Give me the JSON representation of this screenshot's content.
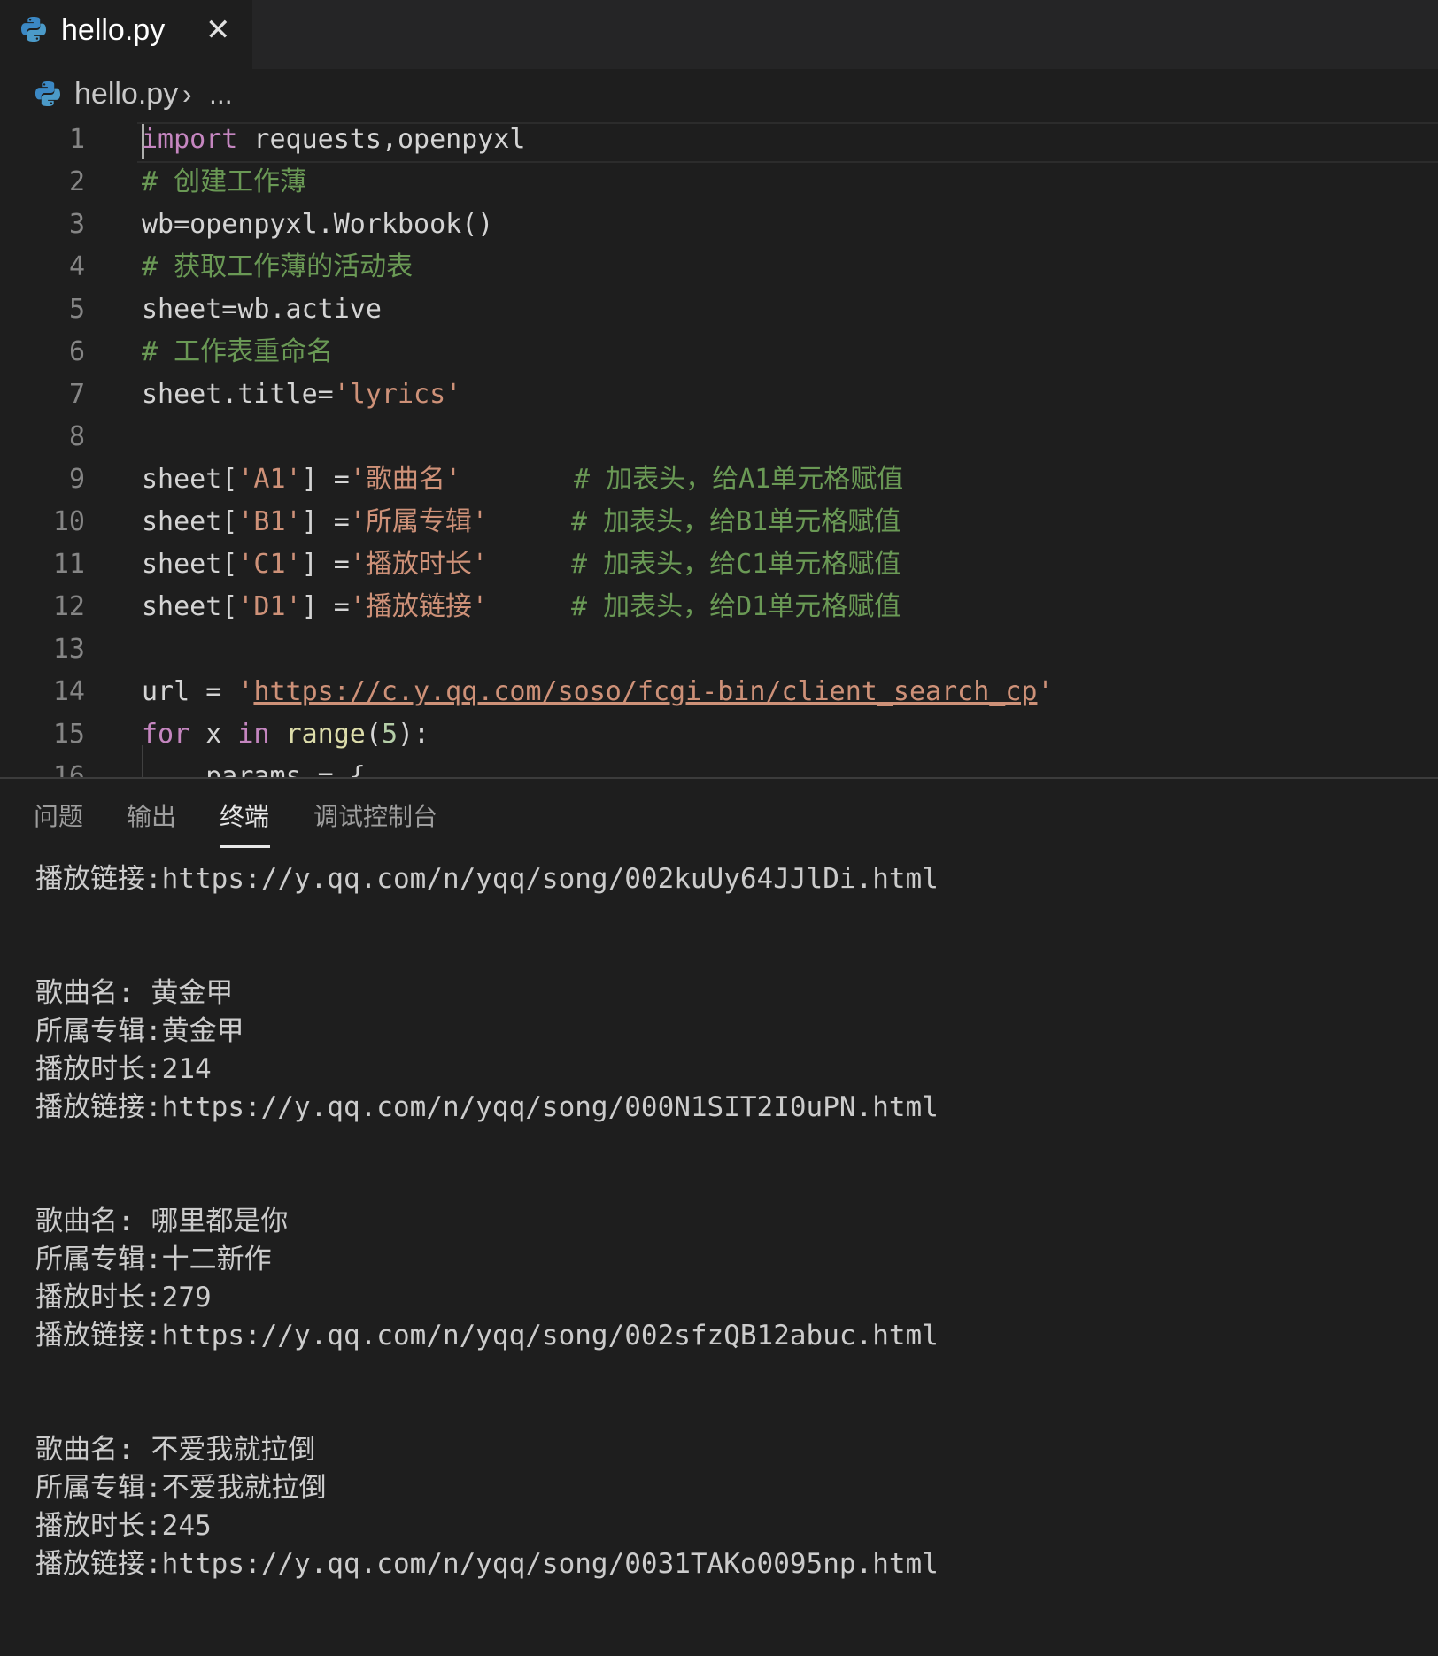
{
  "tab": {
    "filename": "hello.py",
    "close_glyph": "✕"
  },
  "breadcrumb": {
    "file": "hello.py",
    "separator": "›",
    "more": "..."
  },
  "editor": {
    "line_numbers": [
      "1",
      "2",
      "3",
      "4",
      "5",
      "6",
      "7",
      "8",
      "9",
      "10",
      "11",
      "12",
      "13",
      "14",
      "15",
      "16"
    ],
    "l1": {
      "kw": "import",
      "rest": " requests,openpyxl"
    },
    "l2": {
      "comment": "# 创建工作薄"
    },
    "l3": {
      "code": "wb=openpyxl.Workbook()"
    },
    "l4": {
      "comment": "# 获取工作薄的活动表"
    },
    "l5": {
      "code": "sheet=wb.active"
    },
    "l6": {
      "comment": "# 工作表重命名"
    },
    "l7": {
      "code": "sheet.title=",
      "str": "'lyrics'"
    },
    "l9": {
      "a": "sheet[",
      "key": "'A1'",
      "b": "] =",
      "str": "'歌曲名'",
      "comment": "# 加表头，给A1单元格赋值"
    },
    "l10": {
      "a": "sheet[",
      "key": "'B1'",
      "b": "] =",
      "str": "'所属专辑'",
      "comment": "# 加表头，给B1单元格赋值"
    },
    "l11": {
      "a": "sheet[",
      "key": "'C1'",
      "b": "] =",
      "str": "'播放时长'",
      "comment": "# 加表头，给C1单元格赋值"
    },
    "l12": {
      "a": "sheet[",
      "key": "'D1'",
      "b": "] =",
      "str": "'播放链接'",
      "comment": "# 加表头，给D1单元格赋值"
    },
    "l14": {
      "a": "url = ",
      "q1": "'",
      "url": "https://c.y.qq.com/soso/fcgi-bin/client_search_cp",
      "q2": "'"
    },
    "l15": {
      "kw1": "for",
      "x": " x ",
      "kw2": "in",
      "sp": " ",
      "fn": "range",
      "p1": "(",
      "num": "5",
      "p2": "):"
    },
    "l16": {
      "code": "    params = {"
    }
  },
  "panel": {
    "tabs": [
      "问题",
      "输出",
      "终端",
      "调试控制台"
    ],
    "active_tab": "终端"
  },
  "terminal": {
    "lines": [
      "播放链接:https://y.qq.com/n/yqq/song/002kuUy64JJlDi.html",
      "",
      "",
      "歌曲名: 黄金甲",
      "所属专辑:黄金甲",
      "播放时长:214",
      "播放链接:https://y.qq.com/n/yqq/song/000N1SIT2I0uPN.html",
      "",
      "",
      "歌曲名: 哪里都是你",
      "所属专辑:十二新作",
      "播放时长:279",
      "播放链接:https://y.qq.com/n/yqq/song/002sfzQB12abuc.html",
      "",
      "",
      "歌曲名: 不爱我就拉倒",
      "所属专辑:不爱我就拉倒",
      "播放时长:245",
      "播放链接:https://y.qq.com/n/yqq/song/0031TAKo0095np.html"
    ]
  },
  "colors": {
    "background": "#1e1e1e",
    "keyword": "#c586c0",
    "comment": "#6a9955",
    "string": "#ce9178",
    "function": "#dcdcaa",
    "number": "#b5cea8"
  },
  "icons": {
    "file_icon": "python-icon"
  }
}
